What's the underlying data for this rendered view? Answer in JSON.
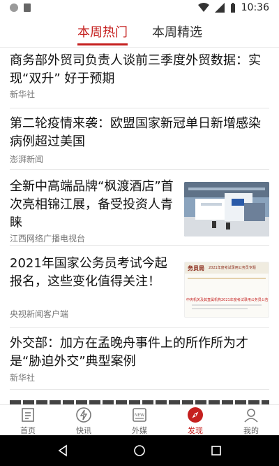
{
  "status": {
    "time": "10:36"
  },
  "tabs": {
    "hot": "本周热门",
    "select": "本周精选"
  },
  "feed": [
    {
      "title": "商务部外贸司负责人谈前三季度外贸数据：实现“双升” 好于预期",
      "source": "新华社"
    },
    {
      "title": "第二轮疫情来袭：欧盟国家新冠单日新增感染病例超过美国",
      "source": "澎湃新闻"
    },
    {
      "title": "全新中高端品牌“枫渡酒店”首次亮相锦江展，备受投资人青睐",
      "source": "江西网络广播电视台"
    },
    {
      "title": "2021年国家公务员考试今起报名，这些变化值得关注！",
      "source": "央视新闻客户端",
      "thumb_header": "务员局",
      "thumb_sub": "2021年度考试录用公务员专题",
      "thumb_caption": "中央机关及其直属机构2021年度考试录用公务员公告"
    },
    {
      "title": "外交部：加方在孟晚舟事件上的所作所为才是“胁迫外交”典型案例",
      "source": "新华社"
    }
  ],
  "tabbar": {
    "home": "首页",
    "flash": "快讯",
    "external": "外媒",
    "discover": "发现",
    "mine": "我的",
    "external_badge": "NEW"
  },
  "colors": {
    "accent": "#c5201f"
  },
  "icons": {
    "home": "home-document-icon",
    "flash": "lightning-icon",
    "external": "newspaper-icon",
    "discover": "compass-icon",
    "mine": "user-icon"
  }
}
